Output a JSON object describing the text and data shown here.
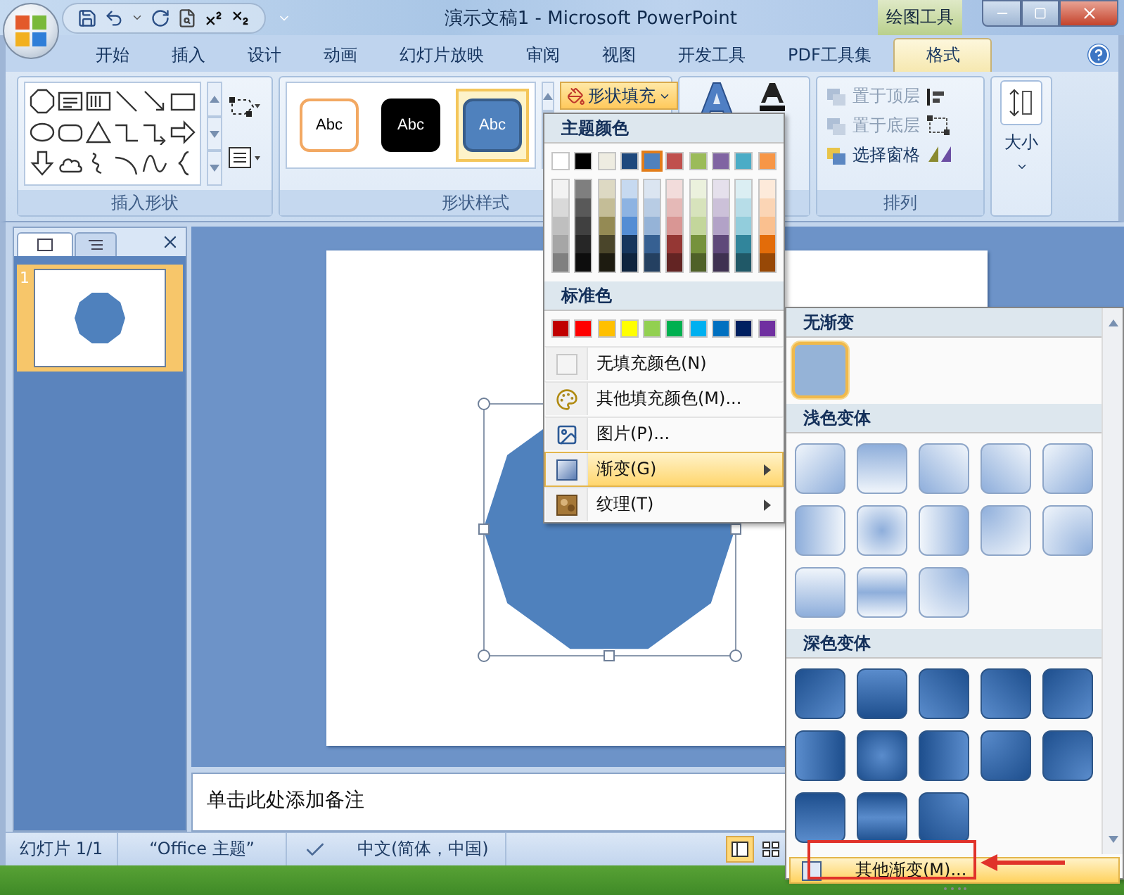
{
  "title_bar": {
    "title": "演示文稿1 - Microsoft PowerPoint",
    "context_label": "绘图工具"
  },
  "tabs": [
    {
      "label": "开始",
      "selected": false
    },
    {
      "label": "插入",
      "selected": false
    },
    {
      "label": "设计",
      "selected": false
    },
    {
      "label": "动画",
      "selected": false
    },
    {
      "label": "幻灯片放映",
      "selected": false
    },
    {
      "label": "审阅",
      "selected": false
    },
    {
      "label": "视图",
      "selected": false
    },
    {
      "label": "开发工具",
      "selected": false
    },
    {
      "label": "PDF工具集",
      "selected": false
    },
    {
      "label": "格式",
      "selected": true
    }
  ],
  "ribbon": {
    "insert_shapes": {
      "label": "插入形状"
    },
    "shape_styles": {
      "label": "形状样式",
      "styles": [
        {
          "kind": "outline",
          "label": "Abc",
          "selected": false
        },
        {
          "kind": "dark",
          "label": "Abc",
          "selected": false
        },
        {
          "kind": "blue",
          "label": "Abc",
          "selected": true
        }
      ],
      "fill_button": {
        "label": "形状填充",
        "open": true
      }
    },
    "arrange": {
      "label": "排列",
      "buttons": [
        {
          "kind": "front",
          "label": "置于顶层",
          "disabled": true
        },
        {
          "kind": "back",
          "label": "置于底层",
          "disabled": true
        },
        {
          "kind": "pane",
          "label": "选择窗格",
          "disabled": false
        }
      ]
    },
    "size": {
      "label": "大小"
    }
  },
  "slides_panel": {
    "tabs": [
      {
        "kind": "slides",
        "selected": true
      },
      {
        "kind": "outline",
        "selected": false
      }
    ],
    "slides": [
      {
        "number": "1",
        "selected": true
      }
    ]
  },
  "notes": {
    "placeholder": "单击此处添加备注"
  },
  "status_bar": {
    "slide": "幻灯片 1/1",
    "theme": "“Office 主题”",
    "language": "中文(简体，中国)"
  },
  "fill_menu": {
    "theme_header": "主题颜色",
    "theme_colors": [
      {
        "color": "#ffffff",
        "selected": false,
        "shades": [
          {
            "color": "#f2f2f2"
          },
          {
            "color": "#d9d9d9"
          },
          {
            "color": "#bfbfbf"
          },
          {
            "color": "#a6a6a6"
          },
          {
            "color": "#808080"
          }
        ]
      },
      {
        "color": "#000000",
        "selected": false,
        "shades": [
          {
            "color": "#7f7f7f"
          },
          {
            "color": "#595959"
          },
          {
            "color": "#404040"
          },
          {
            "color": "#262626"
          },
          {
            "color": "#0d0d0d"
          }
        ]
      },
      {
        "color": "#eeece1",
        "selected": false,
        "shades": [
          {
            "color": "#ddd9c3"
          },
          {
            "color": "#c4bd97"
          },
          {
            "color": "#948a54"
          },
          {
            "color": "#4a452a"
          },
          {
            "color": "#1d1b10"
          }
        ]
      },
      {
        "color": "#1f497d",
        "selected": false,
        "shades": [
          {
            "color": "#c6d9f0"
          },
          {
            "color": "#8db3e2"
          },
          {
            "color": "#548dd4"
          },
          {
            "color": "#17365d"
          },
          {
            "color": "#0f243e"
          }
        ]
      },
      {
        "color": "#4f81bd",
        "selected": true,
        "shades": [
          {
            "color": "#dbe5f1"
          },
          {
            "color": "#b8cce4"
          },
          {
            "color": "#95b3d7"
          },
          {
            "color": "#366092"
          },
          {
            "color": "#244061"
          }
        ]
      },
      {
        "color": "#c0504d",
        "selected": false,
        "shades": [
          {
            "color": "#f2dcdb"
          },
          {
            "color": "#e5b9b7"
          },
          {
            "color": "#d99694"
          },
          {
            "color": "#953734"
          },
          {
            "color": "#632423"
          }
        ]
      },
      {
        "color": "#9bbb59",
        "selected": false,
        "shades": [
          {
            "color": "#ebf1dd"
          },
          {
            "color": "#d7e3bc"
          },
          {
            "color": "#c3d69b"
          },
          {
            "color": "#76923c"
          },
          {
            "color": "#4f6128"
          }
        ]
      },
      {
        "color": "#8064a2",
        "selected": false,
        "shades": [
          {
            "color": "#e5e0ec"
          },
          {
            "color": "#ccc1d9"
          },
          {
            "color": "#b2a2c7"
          },
          {
            "color": "#5f497a"
          },
          {
            "color": "#3f3151"
          }
        ]
      },
      {
        "color": "#4bacc6",
        "selected": false,
        "shades": [
          {
            "color": "#dbeef3"
          },
          {
            "color": "#b7dde8"
          },
          {
            "color": "#92cddc"
          },
          {
            "color": "#31859b"
          },
          {
            "color": "#205867"
          }
        ]
      },
      {
        "color": "#f79646",
        "selected": false,
        "shades": [
          {
            "color": "#fdeada"
          },
          {
            "color": "#fbd5b5"
          },
          {
            "color": "#fac08f"
          },
          {
            "color": "#e36c09"
          },
          {
            "color": "#974806"
          }
        ]
      }
    ],
    "standard_header": "标准色",
    "standard_colors": [
      {
        "color": "#c00000"
      },
      {
        "color": "#ff0000"
      },
      {
        "color": "#ffc000"
      },
      {
        "color": "#ffff00"
      },
      {
        "color": "#92d050"
      },
      {
        "color": "#00b050"
      },
      {
        "color": "#00b0f0"
      },
      {
        "color": "#0070c0"
      },
      {
        "color": "#002060"
      },
      {
        "color": "#7030a0"
      }
    ],
    "items": [
      {
        "kind": "no-fill",
        "label": "无填充颜色(N)",
        "submenu": false,
        "selected": false
      },
      {
        "kind": "more-colors",
        "label": "其他填充颜色(M)...",
        "submenu": false,
        "selected": false
      },
      {
        "kind": "picture",
        "label": "图片(P)...",
        "submenu": false,
        "selected": false
      },
      {
        "kind": "gradient",
        "label": "渐变(G)",
        "submenu": true,
        "selected": true
      },
      {
        "kind": "texture",
        "label": "纹理(T)",
        "submenu": true,
        "selected": false
      }
    ]
  },
  "gradient_menu": {
    "sections": [
      {
        "title": "无渐变",
        "kind": "flat",
        "swatches": [
          {
            "kind": "flat",
            "selected": true
          }
        ]
      },
      {
        "title": "浅色变体",
        "kind": "light",
        "swatches": [
          {
            "kind": "diag-tl",
            "selected": false
          },
          {
            "kind": "down",
            "selected": false
          },
          {
            "kind": "diag-tr",
            "selected": false
          },
          {
            "kind": "diag-bl",
            "selected": false
          },
          {
            "kind": "diag-br",
            "selected": false
          },
          {
            "kind": "right",
            "selected": false
          },
          {
            "kind": "radial",
            "selected": false
          },
          {
            "kind": "left",
            "selected": false
          },
          {
            "kind": "corner-tl",
            "selected": false
          },
          {
            "kind": "corner-br",
            "selected": false
          },
          {
            "kind": "up",
            "selected": false
          },
          {
            "kind": "band",
            "selected": false
          },
          {
            "kind": "corner-tr",
            "selected": false
          }
        ]
      },
      {
        "title": "深色变体",
        "kind": "dark",
        "swatches": [
          {
            "kind": "diag-tl",
            "selected": false
          },
          {
            "kind": "down",
            "selected": false
          },
          {
            "kind": "diag-tr",
            "selected": false
          },
          {
            "kind": "diag-bl",
            "selected": false
          },
          {
            "kind": "diag-br",
            "selected": false
          },
          {
            "kind": "right",
            "selected": false
          },
          {
            "kind": "radial",
            "selected": false
          },
          {
            "kind": "left",
            "selected": false
          },
          {
            "kind": "corner-tl",
            "selected": false
          },
          {
            "kind": "corner-br",
            "selected": false
          },
          {
            "kind": "up",
            "selected": false
          },
          {
            "kind": "band",
            "selected": false
          },
          {
            "kind": "corner-tr",
            "selected": false
          }
        ]
      }
    ],
    "more": {
      "label": "其他渐变(M)...",
      "selected": true,
      "annotated": true
    }
  }
}
